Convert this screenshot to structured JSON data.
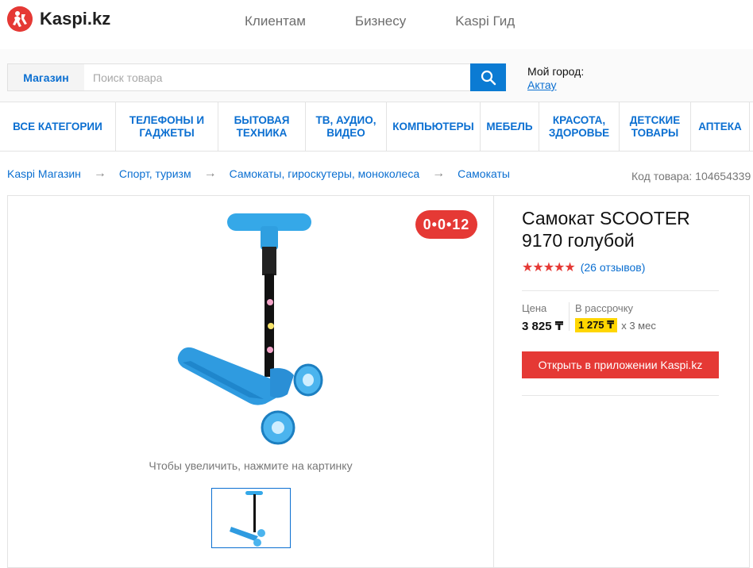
{
  "brand": {
    "name": "Kaspi.kz",
    "accent": "#e53935",
    "link": "#0b6fd1"
  },
  "topnav": [
    "Клиентам",
    "Бизнесу",
    "Kaspi Гид"
  ],
  "search": {
    "tab": "Магазин",
    "placeholder": "Поиск товара",
    "city_label": "Мой город:",
    "city": "Актау"
  },
  "categories": [
    "ВСЕ КАТЕГОРИИ",
    "ТЕЛЕФОНЫ И ГАДЖЕТЫ",
    "БЫТОВАЯ ТЕХНИКА",
    "ТВ, АУДИО, ВИДЕО",
    "КОМПЬЮТЕРЫ",
    "МЕБЕЛЬ",
    "КРАСОТА, ЗДОРОВЬЕ",
    "ДЕТСКИЕ ТОВАРЫ",
    "АПТЕКА"
  ],
  "breadcrumbs": [
    "Kaspi Магазин",
    "Спорт, туризм",
    "Самокаты, гироскутеры, моноколеса",
    "Самокаты"
  ],
  "sku": "Код товара: 104654339",
  "product": {
    "badge": "0•0•12",
    "zoom_hint": "Чтобы увеличить, нажмите на картинку",
    "title": "Самокат SCOOTER 9170 голубой",
    "rating": 4.5,
    "reviews": "(26 отзывов)",
    "price_label": "Цена",
    "price": "3 825 ₸",
    "installment_label": "В рассрочку",
    "installment_amount": "1 275 ₸",
    "installment_term": "x 3 мес",
    "cta": "Открыть в приложении Kaspi.kz"
  }
}
